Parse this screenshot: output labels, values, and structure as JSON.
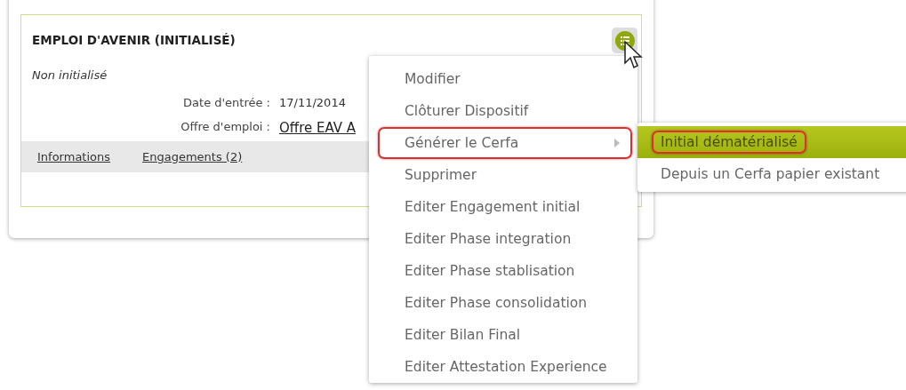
{
  "card": {
    "title": "EMPLOI D'AVENIR (INITIALISÉ)",
    "status": "Non initialisé",
    "fields": [
      {
        "label": "Date d'entrée :",
        "value": "17/11/2014",
        "kind": "text"
      },
      {
        "label": "Offre d'emploi :",
        "value": "Offre EAV A",
        "kind": "link"
      }
    ],
    "tabs": [
      "Informations",
      "Engagements (2)"
    ]
  },
  "menu": {
    "items": [
      {
        "label": "Modifier",
        "has_submenu": false,
        "highlighted": false
      },
      {
        "label": "Clôturer Dispositif",
        "has_submenu": false,
        "highlighted": false
      },
      {
        "label": "Générer le Cerfa",
        "has_submenu": true,
        "highlighted": true
      },
      {
        "label": "Supprimer",
        "has_submenu": false,
        "highlighted": false
      },
      {
        "label": "Editer Engagement initial",
        "has_submenu": false,
        "highlighted": false
      },
      {
        "label": "Editer Phase integration",
        "has_submenu": false,
        "highlighted": false
      },
      {
        "label": "Editer Phase stablisation",
        "has_submenu": false,
        "highlighted": false
      },
      {
        "label": "Editer Phase consolidation",
        "has_submenu": false,
        "highlighted": false
      },
      {
        "label": "Editer Bilan Final",
        "has_submenu": false,
        "highlighted": false
      },
      {
        "label": "Editer Attestation Experience",
        "has_submenu": false,
        "highlighted": false
      }
    ]
  },
  "submenu": {
    "items": [
      {
        "label": "Initial dématérialisé",
        "selected": true,
        "highlighted": true
      },
      {
        "label": "Depuis un Cerfa papier existant",
        "selected": false,
        "highlighted": false
      }
    ]
  }
}
